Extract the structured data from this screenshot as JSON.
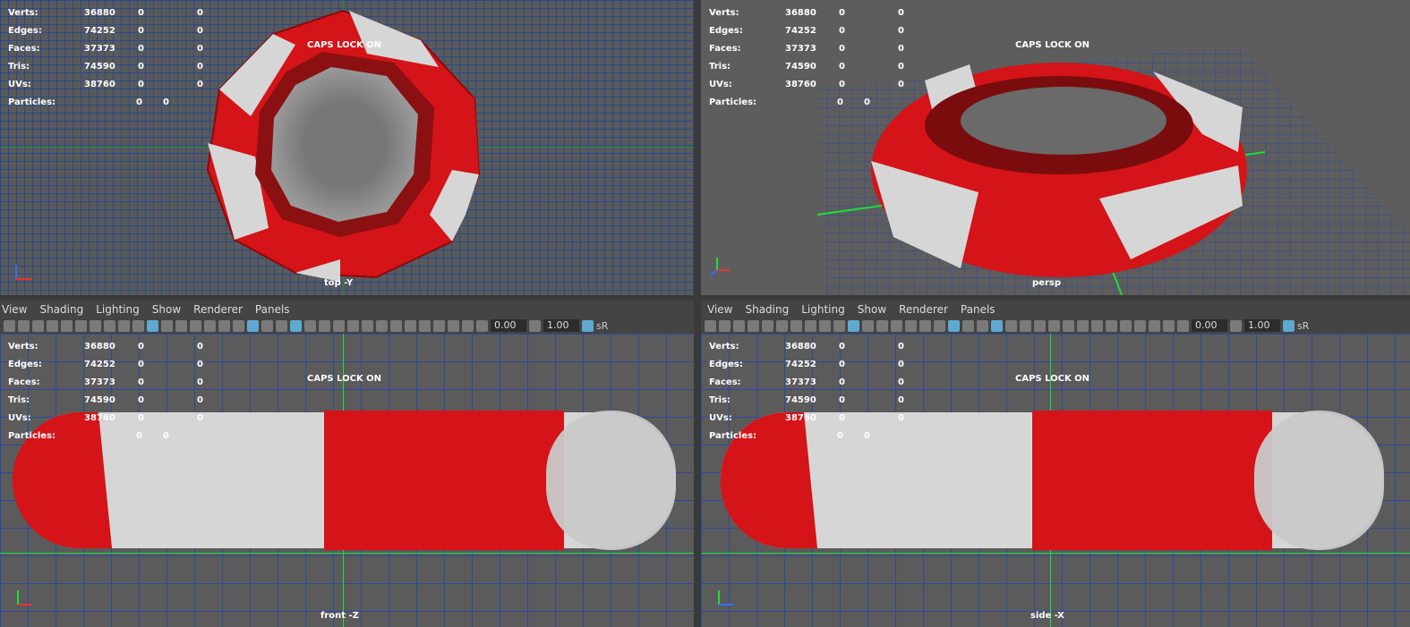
{
  "stats": {
    "labels": [
      "Verts:",
      "Edges:",
      "Faces:",
      "Tris:",
      "UVs:",
      "Particles:"
    ],
    "values": [
      [
        "36880",
        "0",
        "0"
      ],
      [
        "74252",
        "0",
        "0"
      ],
      [
        "37373",
        "0",
        "0"
      ],
      [
        "74590",
        "0",
        "0"
      ],
      [
        "38760",
        "0",
        "0"
      ],
      [
        "",
        "0",
        "0"
      ]
    ]
  },
  "caps_lock": "CAPS LOCK ON",
  "menu": [
    "View",
    "Shading",
    "Lighting",
    "Show",
    "Renderer",
    "Panels"
  ],
  "toolbar": {
    "field1": "0.00",
    "field2": "1.00",
    "suffix": "sR"
  },
  "cameras": {
    "top": "top -Y",
    "persp": "persp",
    "front": "front -Z",
    "side": "side -X"
  },
  "colors": {
    "red": "#d41418",
    "white": "#d6d6d6",
    "grid": "#2a4a8a",
    "axis_green": "#1fdc3c"
  }
}
